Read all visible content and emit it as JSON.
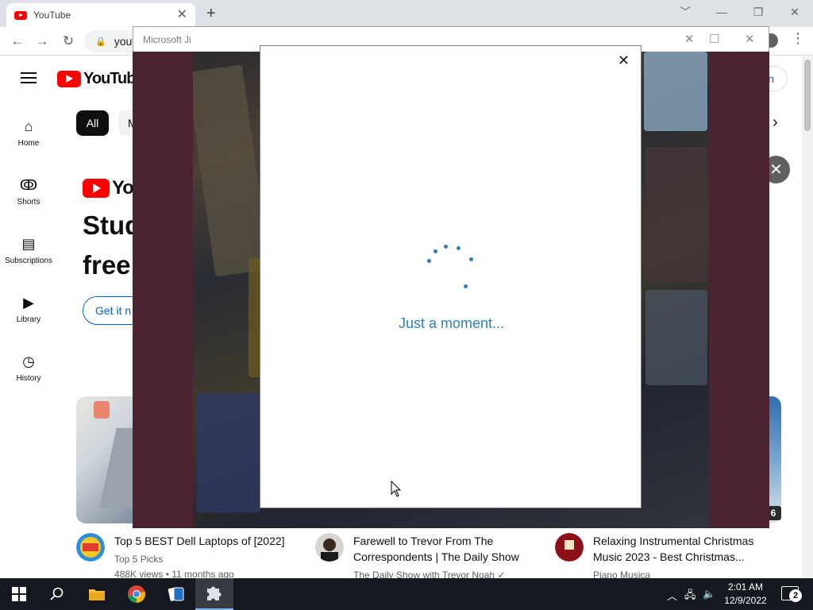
{
  "browser": {
    "tab_title": "YouTube",
    "new_tab": "+",
    "address_text": "yout",
    "window_controls": [
      "﹀",
      "—",
      "❐",
      "✕"
    ]
  },
  "youtube": {
    "logo_text": "YouTube",
    "sign_in_fragment": "n",
    "sidebar": [
      {
        "label": "Home",
        "icon": "home-icon"
      },
      {
        "label": "Shorts",
        "icon": "shorts-icon"
      },
      {
        "label": "Subscriptions",
        "icon": "subscriptions-icon"
      },
      {
        "label": "Library",
        "icon": "library-icon"
      },
      {
        "label": "History",
        "icon": "history-icon"
      }
    ],
    "chips": [
      "All",
      "M"
    ],
    "promo": {
      "logo_fragment": "You",
      "line1": "Stud",
      "line2": "free",
      "button": "Get it n"
    },
    "duration_fragment": "6",
    "videos": [
      {
        "title": "Top 5 BEST Dell Laptops of [2022]",
        "channel": "Top 5 Picks",
        "meta": "488K views • 11 months ago"
      },
      {
        "title": "Farewell to Trevor From The Correspondents | The Daily Show",
        "channel": "The Daily Show with Trevor Noah ✓",
        "meta": ""
      },
      {
        "title": "Relaxing Instrumental Christmas Music 2023 - Best Christmas...",
        "channel": "Piano Musica",
        "meta": ""
      }
    ]
  },
  "app_window": {
    "title": "Microsoft Ji",
    "dialog_message": "Just a moment..."
  },
  "taskbar": {
    "time": "2:01 AM",
    "date": "12/9/2022",
    "notifications": "2"
  },
  "colors": {
    "youtube_red": "#ff0000",
    "link_blue": "#065fd4",
    "app_maroon": "#4b2331",
    "spinner_blue": "#2f7fbf",
    "taskbar": "#15191f"
  }
}
